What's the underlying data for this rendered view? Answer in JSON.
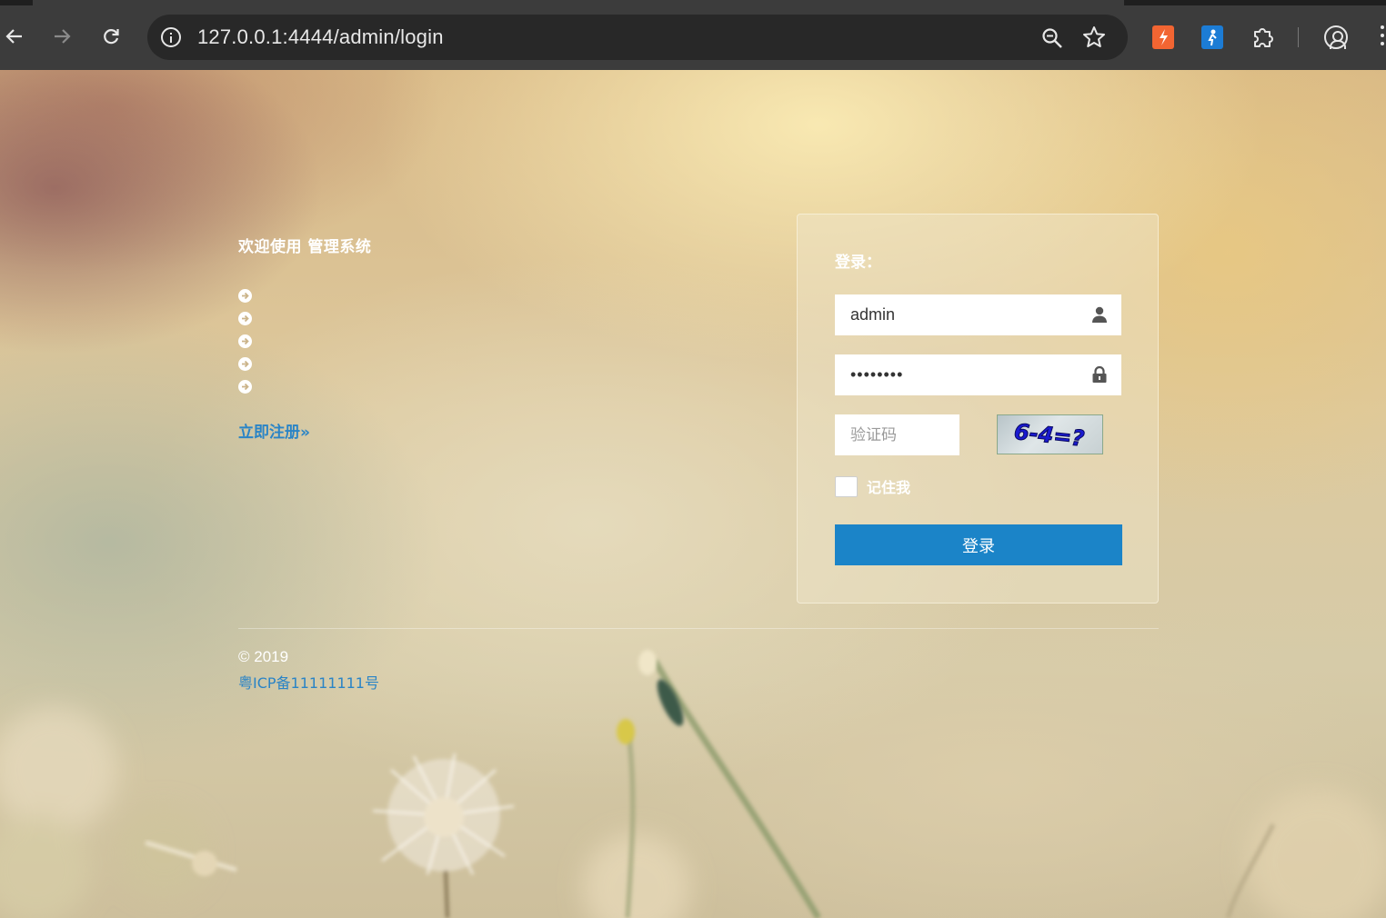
{
  "browser": {
    "url": "127.0.0.1:4444/admin/login",
    "icons": {
      "back": "back-arrow-icon",
      "forward": "forward-arrow-icon",
      "reload": "reload-icon",
      "site_info": "info-icon",
      "zoom": "zoom-icon",
      "bookmark": "star-icon",
      "extensions": "puzzle-icon",
      "profile": "profile-icon",
      "menu": "kebab-menu-icon"
    },
    "extension_colors": [
      "#f26532",
      "#1c7cd5"
    ]
  },
  "intro": {
    "welcome": "欢迎使用 管理系统",
    "feature_count": 5,
    "register_link": "立即注册»"
  },
  "login": {
    "title": "登录：",
    "username_value": "admin",
    "password_value": "••••••••",
    "captcha_placeholder": "验证码",
    "captcha_image_text": "6-4=?",
    "remember_label": "记住我",
    "submit_label": "登录",
    "accent_color": "#1b84c8"
  },
  "footer": {
    "copyright": "© 2019",
    "icp": "粤ICP备11111111号"
  }
}
